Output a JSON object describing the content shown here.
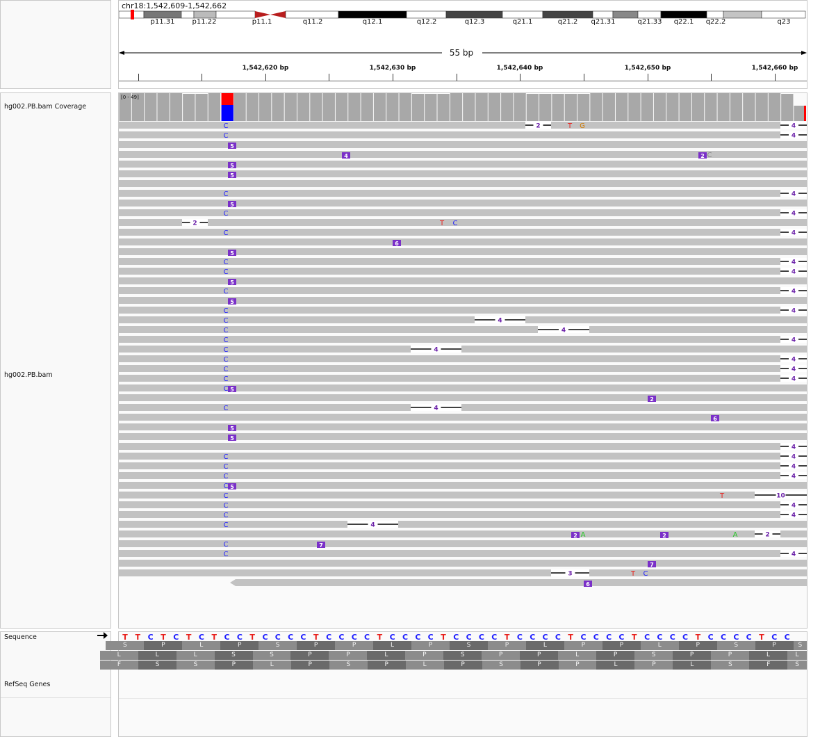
{
  "header": {
    "locus": "chr18:1,542,609-1,542,662",
    "span_label": "55 bp",
    "bands": [
      "p11.31",
      "p11.22",
      "p11.1",
      "q11.2",
      "q12.1",
      "q12.2",
      "q12.3",
      "q21.1",
      "q21.2",
      "q21.31",
      "q21.33",
      "q22.1",
      "q22.2",
      "q23"
    ],
    "ticks": [
      "1,542,620 bp",
      "1,542,630 bp",
      "1,542,640 bp",
      "1,542,650 bp",
      "1,542,660 bp"
    ]
  },
  "tracks": {
    "coverage_name": "hg002.PB.bam Coverage",
    "coverage_range": "[0 - 49]",
    "alignment_name": "hg002.PB.bam",
    "sequence_name": "Sequence",
    "genes_name": "RefSeq Genes"
  },
  "sequence": {
    "bases": "TTCTCTCTCCTCCCCTCCCCTCCCCTCCCCTCCCCTCCCCTCCCCTCCCCTCC",
    "frame1": [
      "S",
      "P",
      "L",
      "P",
      "S",
      "P",
      "P",
      "L",
      "P",
      "S",
      "P",
      "L",
      "P",
      "P",
      "L",
      "P",
      "S",
      "P"
    ],
    "frame2": [
      "L",
      "L",
      "L",
      "S",
      "S",
      "P",
      "P",
      "L",
      "P",
      "S",
      "P",
      "P",
      "L",
      "P",
      "S",
      "P",
      "P",
      "L"
    ],
    "frame3": [
      "F",
      "S",
      "S",
      "P",
      "L",
      "P",
      "S",
      "P",
      "L",
      "P",
      "S",
      "P",
      "P",
      "L",
      "P",
      "L",
      "S"
    ]
  },
  "colors": {
    "read": "#c2c2c2",
    "coverage_bar": "#a8a8a8",
    "mismatch_C": "#1e1eff",
    "mismatch_T": "#e8201c",
    "mismatch_A": "#27c727",
    "mismatch_G": "#d07a00",
    "insertion": "#7a2fc8",
    "deletion_label": "#6a1fa8"
  }
}
